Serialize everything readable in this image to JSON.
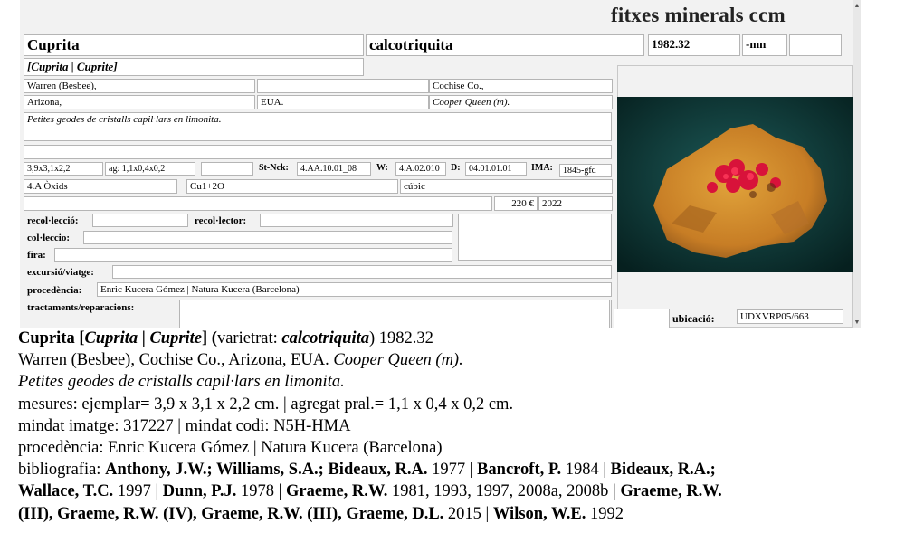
{
  "header": {
    "app_title": "fitxes minerals ccm"
  },
  "record": {
    "species": "Cuprita",
    "variety": "calcotriquita",
    "number": "1982.32",
    "suffix": "-mn",
    "extra_box": "",
    "names": "[Cuprita | Cuprite]",
    "locality1": "Warren (Besbee),",
    "locality2": "",
    "county": "Cochise Co.,",
    "state": "Arizona,",
    "country": "EUA.",
    "mine": "Cooper Queen (m).",
    "description": "Petites geodes de cristalls capil·lars en limonita.",
    "notes_line": "",
    "size_specimen": "3,9x3,1x2,2",
    "size_aggregate": "ag: 1,1x0,4x0,2",
    "blank_box": "",
    "strunz_label": "St-Nck:",
    "strunz_value": "4.AA.10.01_08",
    "w_label": "W:",
    "w_value": "4.A.02.010",
    "d_label": "D:",
    "d_value": "04.01.01.01",
    "ima_label": "IMA:",
    "ima_value": "1845-gfd",
    "class": "4.A Òxids",
    "formula": "Cu1+2O",
    "crystal_system": "cúbic",
    "price": "220 €",
    "year": "2022",
    "collection_label": "recol·lecció:",
    "collection_value": "",
    "collector_label": "recol·lector:",
    "collector_value": "",
    "coleccio_label": "col·leccio:",
    "coleccio_value": "",
    "fira_label": "fira:",
    "fira_value": "",
    "trip_label": "excursió/viatge:",
    "trip_value": "",
    "origin_label": "procedència:",
    "origin_value": "Enric Kucera Gómez | Natura Kucera (Barcelona)",
    "treatments_label": "tractaments/reparacions:",
    "treatments_value": "",
    "ubicacio_blank": "",
    "ubicacio_label": "ubicació:",
    "ubicacio_value": "UDXVRP05/663"
  },
  "summary": {
    "l1_a": "Cuprita [",
    "l1_b": "Cuprita",
    "l1_c": " | ",
    "l1_d": "Cuprite",
    "l1_e": "] (",
    "l1_f": "varietrat: ",
    "l1_g": "calcotriquita",
    "l1_h": ") 1982.32",
    "l2_a": "Warren (Besbee), Cochise Co., Arizona, EUA. ",
    "l2_b": "Cooper Queen (m).",
    "l3": "Petites geodes de cristalls capil·lars en limonita.",
    "l4": "mesures: ejemplar= 3,9 x 3,1 x 2,2 cm. | agregat pral.= 1,1 x 0,4 x 0,2 cm.",
    "l5": "mindat imatge: 317227 | mindat codi: N5H-HMA",
    "l6": "procedència: Enric Kucera Gómez | Natura Kucera (Barcelona)",
    "l7_a": "bibliografia: ",
    "l7_b": "Anthony, J.W.; Williams, S.A.; Bideaux, R.A.",
    "l7_c": " 1977 | ",
    "l7_d": "Bancroft, P.",
    "l7_e": " 1984 | ",
    "l7_f": "Bideaux, R.A.;",
    "l8_a": "Wallace, T.C.",
    "l8_b": " 1997 | ",
    "l8_c": "Dunn, P.J.",
    "l8_d": " 1978 | ",
    "l8_e": "Graeme, R.W.",
    "l8_f": " 1981, 1993, 1997, 2008a, 2008b | ",
    "l8_g": "Graeme, R.W.",
    "l9_a": "(III), Graeme, R.W. (IV), Graeme, R.W. (III), Graeme, D.L.",
    "l9_b": " 2015 | ",
    "l9_c": "Wilson, W.E.",
    "l9_d": " 1992"
  },
  "colors": {
    "form_bg": "#f2f2f2",
    "photo_bg": "#0d3b3a",
    "field_border": "#b5b5b5"
  }
}
